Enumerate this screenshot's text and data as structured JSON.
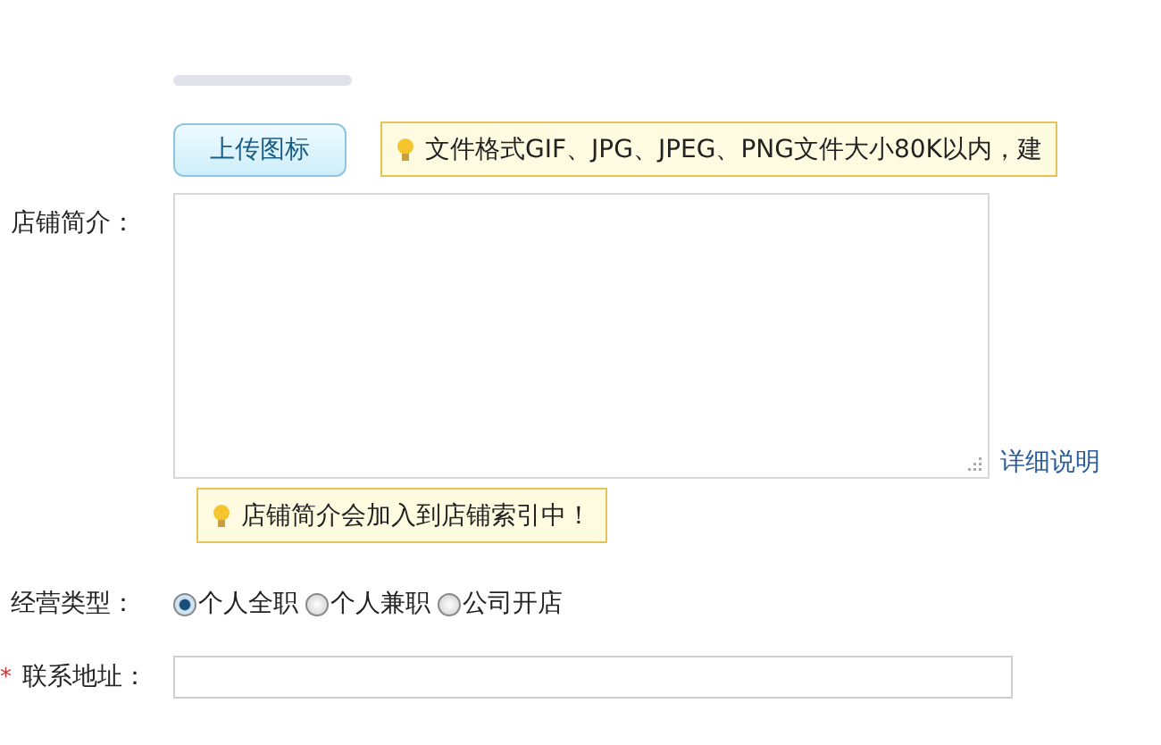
{
  "upload": {
    "button": "上传图标",
    "hint": "文件格式GIF、JPG、JPEG、PNG文件大小80K以内，建"
  },
  "intro": {
    "label": "店铺简介：",
    "link": "详细说明",
    "hint": "店铺简介会加入到店铺索引中！"
  },
  "business_type": {
    "label": "经营类型：",
    "options": [
      {
        "label": "个人全职",
        "selected": true
      },
      {
        "label": "个人兼职",
        "selected": false
      },
      {
        "label": "公司开店",
        "selected": false
      }
    ]
  },
  "address": {
    "required_mark": "*",
    "label": "联系地址："
  }
}
